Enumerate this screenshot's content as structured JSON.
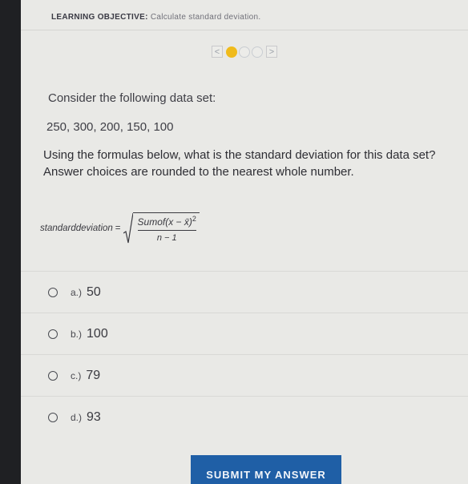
{
  "header": {
    "objective_label": "LEARNING OBJECTIVE:",
    "objective_text": "Calculate standard deviation."
  },
  "pager": {
    "prev_icon": "chevron-left-icon",
    "next_icon": "chevron-right-icon",
    "prev_glyph": "<",
    "next_glyph": ">",
    "current": 1,
    "total": 3,
    "active_color": "#f0bb1c"
  },
  "question": {
    "intro": "Consider the following data set:",
    "data_set": "250, 300, 200, 150, 100",
    "prompt": "Using the formulas below, what is the standard deviation for this data set? Answer choices are rounded to the nearest whole number."
  },
  "formula": {
    "lhs": "standarddeviation",
    "equals": "=",
    "numerator": "Sumof(x − x̄)",
    "exponent": "2",
    "denominator": "n − 1"
  },
  "options": [
    {
      "letter": "a.)",
      "value": "50"
    },
    {
      "letter": "b.)",
      "value": "100"
    },
    {
      "letter": "c.)",
      "value": "79"
    },
    {
      "letter": "d.)",
      "value": "93"
    }
  ],
  "submit": {
    "label": "SUBMIT MY ANSWER",
    "color": "#1f5fa6"
  }
}
